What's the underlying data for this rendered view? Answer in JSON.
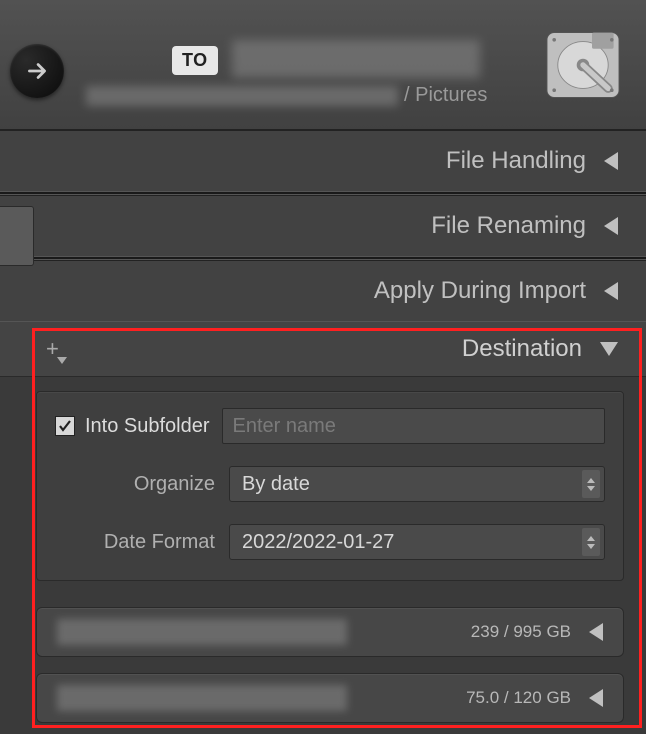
{
  "header": {
    "to_badge": "TO",
    "path_suffix": "/ Pictures"
  },
  "panels": {
    "file_handling": {
      "title": "File Handling",
      "expanded": false
    },
    "file_renaming": {
      "title": "File Renaming",
      "expanded": false
    },
    "apply_during": {
      "title": "Apply During Import",
      "expanded": false
    },
    "destination": {
      "title": "Destination",
      "expanded": true,
      "into_subfolder": {
        "label": "Into Subfolder",
        "checked": true,
        "placeholder": "Enter name",
        "value": ""
      },
      "organize": {
        "label": "Organize",
        "value": "By date"
      },
      "date_format": {
        "label": "Date Format",
        "value": "2022/2022-01-27"
      },
      "volumes": [
        {
          "used": "239",
          "total": "995",
          "unit": "GB"
        },
        {
          "used": "75.0",
          "total": "120",
          "unit": "GB"
        }
      ]
    }
  }
}
